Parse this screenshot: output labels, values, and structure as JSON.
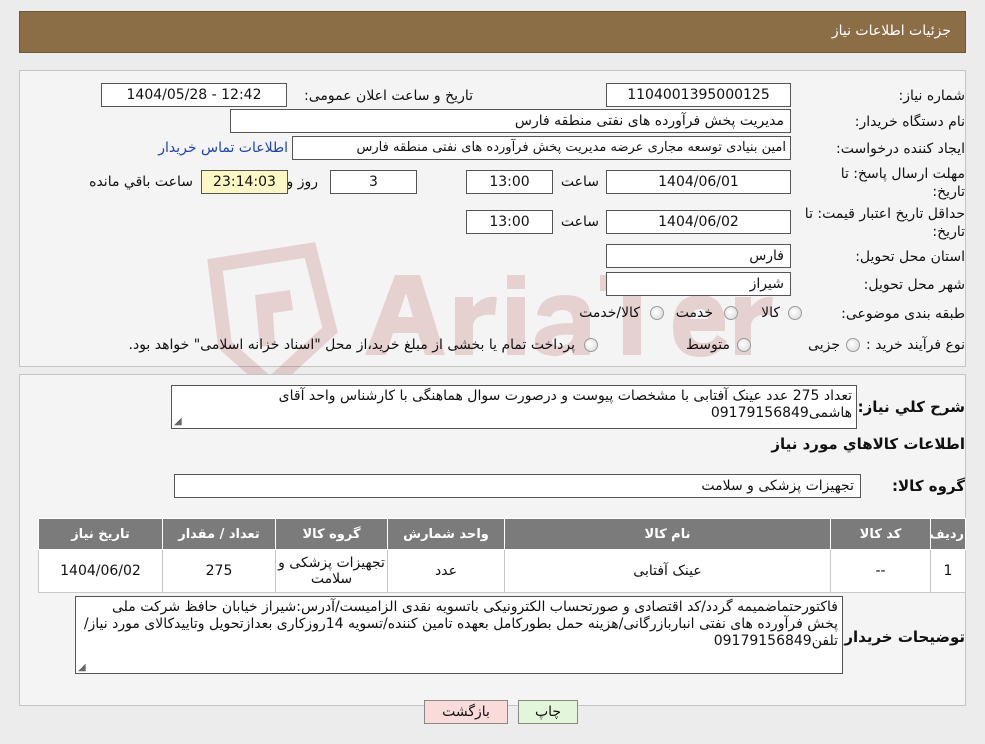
{
  "header": {
    "title": "جزئیات اطلاعات نیاز"
  },
  "form": {
    "need_number_label": "شماره نیاز:",
    "need_number": "1104001395000125",
    "announce_label": "تاریخ و ساعت اعلان عمومی:",
    "announce_value": "1404/05/28 - 12:42",
    "buyer_org_label": "نام دستگاه خریدار:",
    "buyer_org": "مدیریت پخش فرآورده های نفتی منطقه فارس",
    "creator_label": "ایجاد کننده درخواست:",
    "creator": "امین بنیادی توسعه مجاری عرضه مدیریت پخش فرآورده های نفتی منطقه فارس",
    "contact_link": "اطلاعات تماس خریدار",
    "deadline_label_1": "مهلت ارسال پاسخ: تا",
    "deadline_label_2": "تاریخ:",
    "deadline_date": "1404/06/01",
    "time_label": "ساعت",
    "deadline_time": "13:00",
    "deadline_days": "3",
    "days_label": "روز و",
    "remaining_time": "23:14:03",
    "remaining_label": "ساعت باقي مانده",
    "validity_label_1": "حداقل تاریخ اعتبار قیمت: تا",
    "validity_label_2": "تاریخ:",
    "validity_date": "1404/06/02",
    "validity_time": "13:00",
    "province_label": "استان محل تحویل:",
    "province": "فارس",
    "city_label": "شهر محل تحویل:",
    "city": "شیراز",
    "category_label": "طبقه بندی موضوعی:",
    "category_options": [
      "کالا",
      "خدمت",
      "کالا/خدمت"
    ],
    "purchase_type_label": "نوع فرآیند خرید :",
    "purchase_options": [
      "جزیی",
      "متوسط"
    ],
    "purchase_note": "پرداخت تمام یا بخشی از مبلغ خرید،از محل \"اسناد خزانه اسلامی\" خواهد بود."
  },
  "summary": {
    "label": "شرح کلي نياز:",
    "text": "تعداد 275 عدد عینک آفتابی با مشخصات پیوست و درصورت سوال هماهنگی با کارشناس واحد آقای هاشمی09179156849",
    "goods_info_title": "اطلاعات کالاهاي مورد نياز",
    "group_label": "گروه کالا:",
    "group_value": "تجهیزات پزشکی و سلامت"
  },
  "table": {
    "headers": [
      "ردیف",
      "کد کالا",
      "نام کالا",
      "واحد شمارش",
      "گروه کالا",
      "تعداد / مقدار",
      "تاریخ نیاز"
    ],
    "rows": [
      [
        "1",
        "--",
        "عینک آفتابی",
        "عدد",
        "تجهیزات پزشکی و سلامت",
        "275",
        "1404/06/02"
      ]
    ]
  },
  "buyer_notes": {
    "label": "توضیحات خریدار:",
    "text": "فاکتورحتماضمیمه گردد/کد اقتصادی و صورتحساب الکترونیکی باتسویه نقدی الزامیست/آدرس:شیراز خیابان حافظ شرکت ملی پخش فرآورده های نفتی انباربازرگانی/هزینه حمل بطورکامل بعهده تامین کننده/تسویه 14روزکاری بعدازتحویل وتاییدکالای مورد نیاز/تلفن09179156849"
  },
  "buttons": {
    "print": "چاپ",
    "back": "بازگشت"
  },
  "colors": {
    "header_bg": "#8b6e45",
    "table_header_bg": "#7b7b7b",
    "timer_bg": "#fdf7c3",
    "back_button_bg": "#fbdada",
    "print_button_bg": "#e3f6dc"
  }
}
